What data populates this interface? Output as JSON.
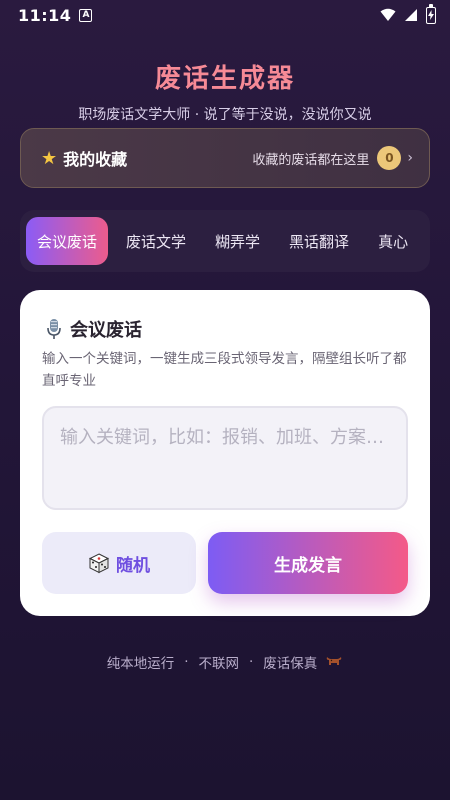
{
  "status_bar": {
    "time": "11:14",
    "indicator": "A",
    "battery_icon": "battery-charging-icon"
  },
  "header": {
    "title": "废话生成器",
    "subtitle": "职场废话文学大师 · 说了等于没说，没说你又说"
  },
  "favorites": {
    "icon": "star-icon",
    "title": "我的收藏",
    "description": "收藏的废话都在这里",
    "count": "0",
    "chevron": "›"
  },
  "tabs": [
    {
      "label": "会议废话",
      "active": true
    },
    {
      "label": "废话文学",
      "active": false
    },
    {
      "label": "糊弄学",
      "active": false
    },
    {
      "label": "黑话翻译",
      "active": false
    },
    {
      "label": "真心",
      "active": false
    }
  ],
  "card": {
    "icon": "microphone-icon",
    "title": "会议废话",
    "description": "输入一个关键词，一键生成三段式领导发言，隔壁组长听了都直呼专业",
    "input_placeholder": "输入关键词，比如：报销、加班、方案…",
    "input_value": "",
    "random_button": "随机",
    "random_icon": "dice-icon",
    "generate_button": "生成发言"
  },
  "footer": {
    "items": [
      "纯本地运行",
      "不联网",
      "废话保真"
    ],
    "separator": "·",
    "icon": "bull-icon"
  },
  "colors": {
    "title": "#f68a96",
    "tab_active_start": "#8b5cf6",
    "tab_active_end": "#ec5c8c",
    "accent_purple": "#6f4fe0",
    "badge": "#ecc779"
  }
}
